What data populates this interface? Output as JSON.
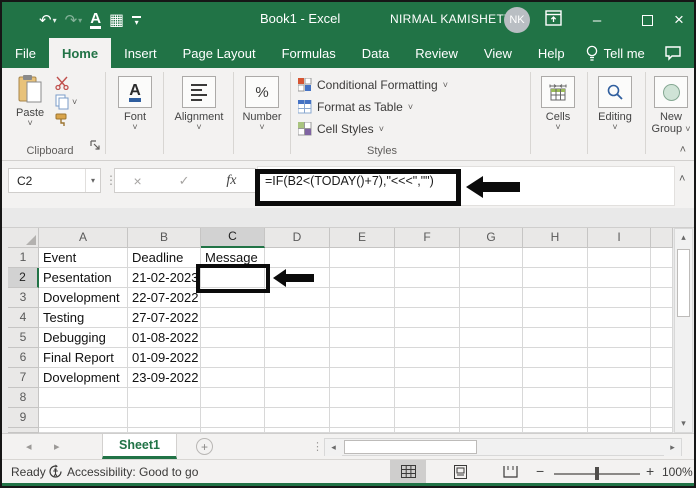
{
  "window": {
    "title": "Book1 - Excel",
    "user_name": "NIRMAL KAMISHETTY",
    "avatar_initials": "NK",
    "minimize_glyph": "–",
    "close_glyph": "×"
  },
  "tabs": {
    "items": [
      "File",
      "Home",
      "Insert",
      "Page Layout",
      "Formulas",
      "Data",
      "Review",
      "View",
      "Help"
    ],
    "active": "Home",
    "tell_me": "Tell me"
  },
  "ribbon": {
    "paste": "Paste",
    "clipboard_group": "Clipboard",
    "font_group": "Font",
    "font_icon": "A",
    "alignment_group": "Alignment",
    "number_group": "Number",
    "number_icon": "%",
    "styles": {
      "conditional_formatting": "Conditional Formatting",
      "format_as_table": "Format as Table",
      "cell_styles": "Cell Styles",
      "group_label": "Styles"
    },
    "cells": "Cells",
    "editing": "Editing",
    "new_group_line1": "New",
    "new_group_line2": "Group"
  },
  "formula_bar": {
    "name_box": "C2",
    "cancel_glyph": "×",
    "enter_glyph": "✓",
    "insert_function": "fx",
    "formula": "=IF(B2<(TODAY()+7),\"<<<\",\"\")"
  },
  "grid": {
    "columns": [
      "A",
      "B",
      "C",
      "D",
      "E",
      "F",
      "G",
      "H",
      "I"
    ],
    "selected_cell": "C2",
    "selected_column": "C",
    "selected_row": 2,
    "rows": [
      {
        "n": 1,
        "cells": [
          "Event",
          "Deadline",
          "Message"
        ]
      },
      {
        "n": 2,
        "cells": [
          "Pesentation",
          "21-02-2023",
          ""
        ]
      },
      {
        "n": 3,
        "cells": [
          "Dovelopment",
          "22-07-2022",
          ""
        ]
      },
      {
        "n": 4,
        "cells": [
          "Testing",
          "27-07-2022",
          ""
        ]
      },
      {
        "n": 5,
        "cells": [
          "Debugging",
          "01-08-2022",
          ""
        ]
      },
      {
        "n": 6,
        "cells": [
          "Final Report",
          "01-09-2022",
          ""
        ]
      },
      {
        "n": 7,
        "cells": [
          "Dovelopment",
          "23-09-2022",
          ""
        ]
      },
      {
        "n": 8,
        "cells": [
          "",
          "",
          ""
        ]
      },
      {
        "n": 9,
        "cells": [
          "",
          "",
          ""
        ]
      }
    ]
  },
  "sheet_bar": {
    "active_tab": "Sheet1"
  },
  "status_bar": {
    "mode": "Ready",
    "accessibility": "Accessibility: Good to go",
    "zoom_level": "100%"
  },
  "colors": {
    "excel_green": "#217346",
    "annotation_black": "#0b0b0b",
    "selected_header_bg": "#d2d2d2"
  }
}
